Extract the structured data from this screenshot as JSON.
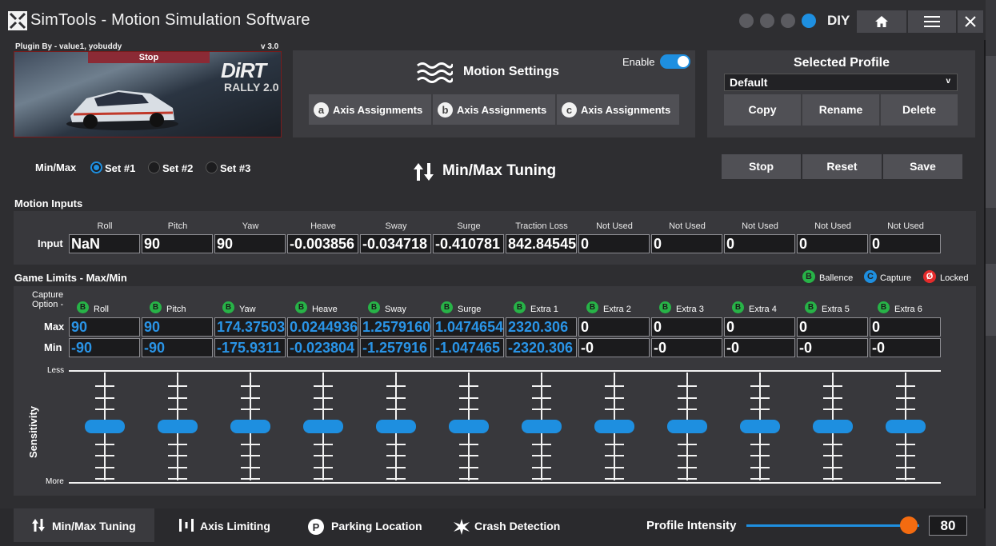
{
  "app": {
    "title": "SimTools - Motion Simulation Software",
    "diy_label": "DIY"
  },
  "titlebar_icons": [
    "download-icon",
    "gear-icon",
    "wrench-icon",
    "power-icon"
  ],
  "plugin": {
    "by": "Plugin By - value1, yobuddy",
    "version": "v 3.0",
    "status_banner": "Stop",
    "game_logo_top": "DiRT",
    "game_logo_bottom": "RALLY 2.0"
  },
  "motion_settings": {
    "title": "Motion Settings",
    "enable_label": "Enable",
    "enabled": true,
    "axis_buttons": [
      {
        "letter": "a",
        "label": "Axis Assignments"
      },
      {
        "letter": "b",
        "label": "Axis Assignments"
      },
      {
        "letter": "c",
        "label": "Axis Assignments"
      }
    ]
  },
  "profile": {
    "title": "Selected Profile",
    "selected": "Default",
    "chevron": "v",
    "buttons": [
      "Copy",
      "Rename",
      "Delete"
    ]
  },
  "minmax": {
    "label": "Min/Max",
    "sets": [
      "Set #1",
      "Set #2",
      "Set #3"
    ],
    "selected_set": 0,
    "title": "Min/Max Tuning",
    "buttons": [
      "Stop",
      "Reset",
      "Save"
    ]
  },
  "motion_inputs": {
    "section_label": "Motion Inputs",
    "row_label": "Input",
    "columns": [
      "Roll",
      "Pitch",
      "Yaw",
      "Heave",
      "Sway",
      "Surge",
      "Traction Loss",
      "Not Used",
      "Not Used",
      "Not Used",
      "Not Used",
      "Not Used"
    ],
    "values": [
      "NaN",
      "90",
      "90",
      "-0.003856",
      "-0.034718",
      "-0.410781",
      "842.84545",
      "0",
      "0",
      "0",
      "0",
      "0"
    ]
  },
  "game_limits": {
    "section_label": "Game Limits - Max/Min",
    "legend": [
      {
        "letter": "B",
        "label": "Ballence",
        "color": "#27b347"
      },
      {
        "letter": "C",
        "label": "Capture",
        "color": "#1e8fe0"
      },
      {
        "letter": "Ø",
        "label": "Locked",
        "color": "#e52b2b"
      }
    ],
    "capture_label_1": "Capture",
    "capture_label_2": "Option -",
    "capture_letter": "B",
    "columns": [
      "Roll",
      "Pitch",
      "Yaw",
      "Heave",
      "Sway",
      "Surge",
      "Extra 1",
      "Extra 2",
      "Extra 3",
      "Extra 4",
      "Extra 5",
      "Extra 6"
    ],
    "max_label": "Max",
    "min_label": "Min",
    "max": [
      "90",
      "90",
      "174.37503",
      "0.0244936",
      "1.2579160",
      "1.0474654",
      "2320.306",
      "0",
      "0",
      "0",
      "0",
      "0"
    ],
    "min": [
      "-90",
      "-90",
      "-175.9311",
      "-0.023804",
      "-1.257916",
      "-1.047465",
      "-2320.306",
      "-0",
      "-0",
      "-0",
      "-0",
      "-0"
    ]
  },
  "sensitivity": {
    "label": "Sensitivity",
    "less": "Less",
    "more": "More",
    "levels": [
      0.5,
      0.5,
      0.5,
      0.5,
      0.5,
      0.5,
      0.5,
      0.5,
      0.5,
      0.5,
      0.5,
      0.5
    ]
  },
  "bottom_tabs": [
    {
      "label": "Min/Max Tuning",
      "icon": "updown-arrows-icon",
      "active": true
    },
    {
      "label": "Axis Limiting",
      "icon": "bars-icon",
      "active": false
    },
    {
      "label": "Parking Location",
      "icon": "parking-icon",
      "active": false
    },
    {
      "label": "Crash Detection",
      "icon": "burst-icon",
      "active": false
    }
  ],
  "profile_intensity": {
    "label": "Profile Intensity",
    "value": "80",
    "fraction": 0.8
  },
  "colors": {
    "accent": "#1e8fe0",
    "knob": "#f36b10",
    "value_blue": "#2a94e6",
    "balance_green": "#27b347",
    "locked_red": "#e52b2b"
  }
}
